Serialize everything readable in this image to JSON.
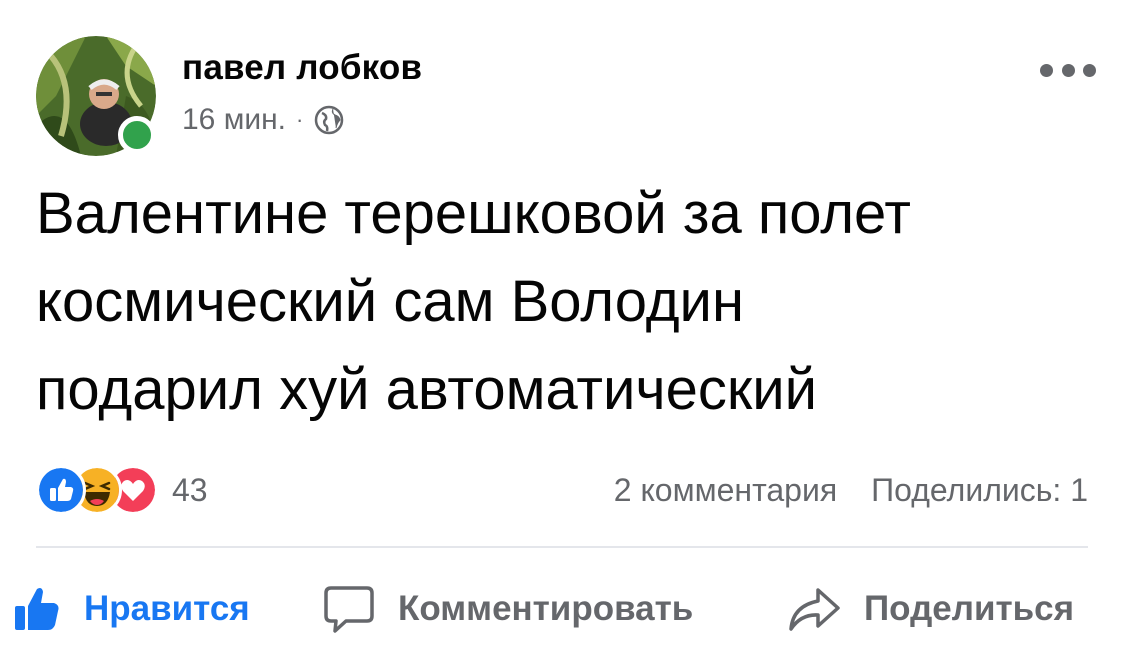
{
  "post": {
    "author": "павел лобков",
    "time": "16 мин.",
    "separator": "·",
    "audience_icon": "globe-icon",
    "text": "Валентине терешковой за полет\nкосмический сам Володин\nподарил хуй автоматический"
  },
  "stats": {
    "reaction_icons": [
      "like-reaction-icon",
      "haha-reaction-icon",
      "love-reaction-icon"
    ],
    "reaction_count": "43",
    "comments": "2 комментария",
    "shares": "Поделились: 1"
  },
  "actions": {
    "like_label": "Нравится",
    "comment_label": "Комментировать",
    "share_label": "Поделиться"
  },
  "colors": {
    "accent": "#1877f2",
    "secondary_text": "#65676b",
    "online": "#31a24c",
    "love": "#f33e58",
    "haha": "#f7b125"
  }
}
